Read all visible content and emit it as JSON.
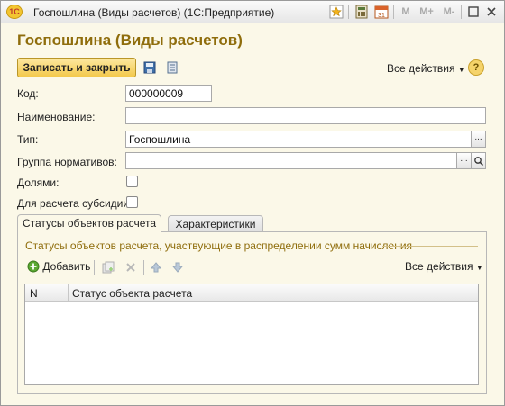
{
  "window": {
    "title": "Госпошлина (Виды расчетов)  (1С:Предприятие)",
    "logo_text": "1C",
    "toolbar_icons": [
      "favorite-star-icon",
      "calculator-icon",
      "calendar-icon"
    ],
    "memory_buttons": [
      "M",
      "M+",
      "M-"
    ],
    "window_controls": [
      "minimize-icon",
      "maximize-icon",
      "close-icon"
    ]
  },
  "form": {
    "title": "Госпошлина (Виды расчетов)",
    "toolbar": {
      "save_close_label": "Записать и закрыть",
      "all_actions_label": "Все действия",
      "help_label": "?"
    },
    "fields": {
      "code_label": "Код:",
      "code_value": "000000009",
      "name_label": "Наименование:",
      "name_value": "",
      "type_label": "Тип:",
      "type_value": "Госпошлина",
      "group_label": "Группа нормативов:",
      "group_value": "",
      "shares_label": "Долями:",
      "subsidy_label": "Для расчета субсидии:"
    },
    "tabs": [
      {
        "label": "Статусы объектов расчета",
        "active": true
      },
      {
        "label": "Характеристики",
        "active": false
      }
    ],
    "panel": {
      "caption": "Статусы объектов расчета, участвующие в распределении сумм начисления",
      "add_label": "Добавить",
      "all_actions_label": "Все действия",
      "columns": [
        "N",
        "Статус объекта расчета"
      ],
      "rows": []
    }
  },
  "colors": {
    "accent_title": "#8f6d0c",
    "primary_button": "#f3c94c",
    "background": "#fbf8e8"
  }
}
